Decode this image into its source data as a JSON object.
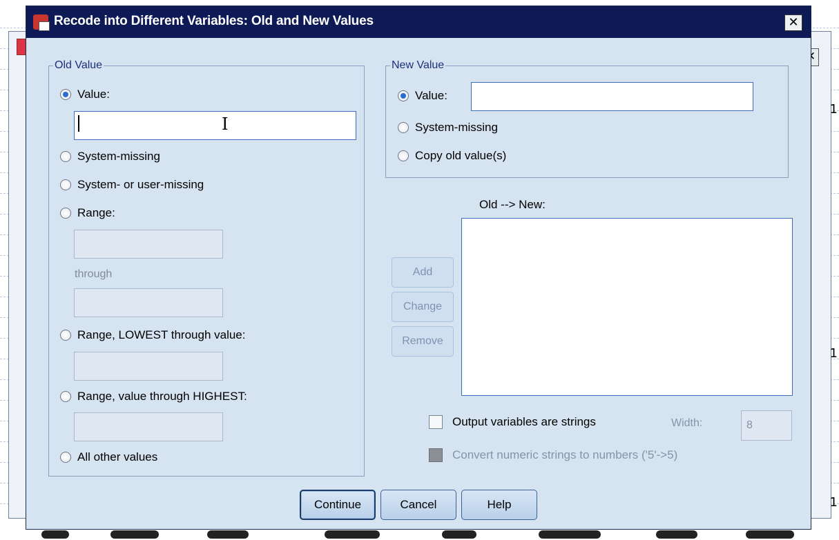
{
  "dialog": {
    "title": "Recode into Different Variables: Old and New Values",
    "close_glyph": "✕"
  },
  "background": {
    "row_numbers": [
      "1",
      "1",
      "1"
    ]
  },
  "old_value": {
    "legend": "Old Value",
    "value_label": "Value:",
    "value_text": "",
    "system_missing": "System-missing",
    "system_or_user_missing": "System- or user-missing",
    "range": "Range:",
    "through": "through",
    "range_lowest": "Range, LOWEST through value:",
    "range_highest": "Range, value through HIGHEST:",
    "all_other": "All other values",
    "selected": "Value:"
  },
  "new_value": {
    "legend": "New Value",
    "value_label": "Value:",
    "value_text": "",
    "system_missing": "System-missing",
    "copy_old": "Copy old value(s)",
    "selected": "Value:"
  },
  "mapping": {
    "label": "Old --> New:",
    "items": []
  },
  "actions": {
    "add": "Add",
    "change": "Change",
    "remove": "Remove"
  },
  "options": {
    "output_strings": "Output variables are strings",
    "output_strings_checked": false,
    "width_label": "Width:",
    "width_value": "8",
    "convert_numeric": "Convert numeric strings to numbers ('5'->5)",
    "convert_numeric_enabled": false
  },
  "footer": {
    "continue": "Continue",
    "cancel": "Cancel",
    "help": "Help"
  },
  "colors": {
    "titlebar": "#0e1a55",
    "dialog_bg": "#d6e3f1",
    "accent": "#2a6bd1"
  }
}
